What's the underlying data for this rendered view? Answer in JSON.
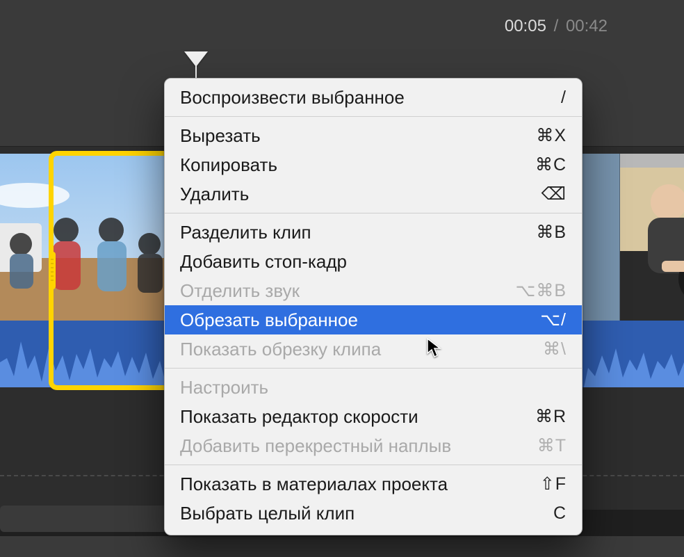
{
  "timecode": {
    "current": "00:05",
    "separator": "/",
    "total": "00:42"
  },
  "menu": {
    "groups": [
      [
        {
          "id": "play-selection",
          "label": "Воспроизвести выбранное",
          "shortcut": "/",
          "enabled": true,
          "highlighted": false
        }
      ],
      [
        {
          "id": "cut",
          "label": "Вырезать",
          "shortcut": "⌘X",
          "enabled": true,
          "highlighted": false
        },
        {
          "id": "copy",
          "label": "Копировать",
          "shortcut": "⌘C",
          "enabled": true,
          "highlighted": false
        },
        {
          "id": "delete",
          "label": "Удалить",
          "shortcut": "⌫",
          "enabled": true,
          "highlighted": false
        }
      ],
      [
        {
          "id": "split-clip",
          "label": "Разделить клип",
          "shortcut": "⌘B",
          "enabled": true,
          "highlighted": false
        },
        {
          "id": "add-freeze-frame",
          "label": "Добавить стоп-кадр",
          "shortcut": "",
          "enabled": true,
          "highlighted": false
        },
        {
          "id": "detach-audio",
          "label": "Отделить звук",
          "shortcut": "⌥⌘B",
          "enabled": false,
          "highlighted": false
        },
        {
          "id": "trim-selection",
          "label": "Обрезать выбранное",
          "shortcut": "⌥/",
          "enabled": true,
          "highlighted": true
        },
        {
          "id": "show-clip-trim",
          "label": "Показать обрезку клипа",
          "shortcut": "⌘\\",
          "enabled": false,
          "highlighted": false
        }
      ],
      [
        {
          "id": "adjust",
          "label": "Настроить",
          "shortcut": "",
          "enabled": false,
          "highlighted": false
        },
        {
          "id": "show-speed-editor",
          "label": "Показать редактор скорости",
          "shortcut": "⌘R",
          "enabled": true,
          "highlighted": false
        },
        {
          "id": "add-cross-dissolve",
          "label": "Добавить перекрестный наплыв",
          "shortcut": "⌘T",
          "enabled": false,
          "highlighted": false
        }
      ],
      [
        {
          "id": "reveal-in-project",
          "label": "Показать в материалах проекта",
          "shortcut": "⇧F",
          "enabled": true,
          "highlighted": false
        },
        {
          "id": "select-whole-clip",
          "label": "Выбрать целый клип",
          "shortcut": "C",
          "enabled": true,
          "highlighted": false
        }
      ]
    ]
  },
  "colors": {
    "selection": "#ffd400",
    "highlight": "#2f6fe0",
    "background": "#3a3a3a",
    "audio": "#3b6cc4"
  }
}
